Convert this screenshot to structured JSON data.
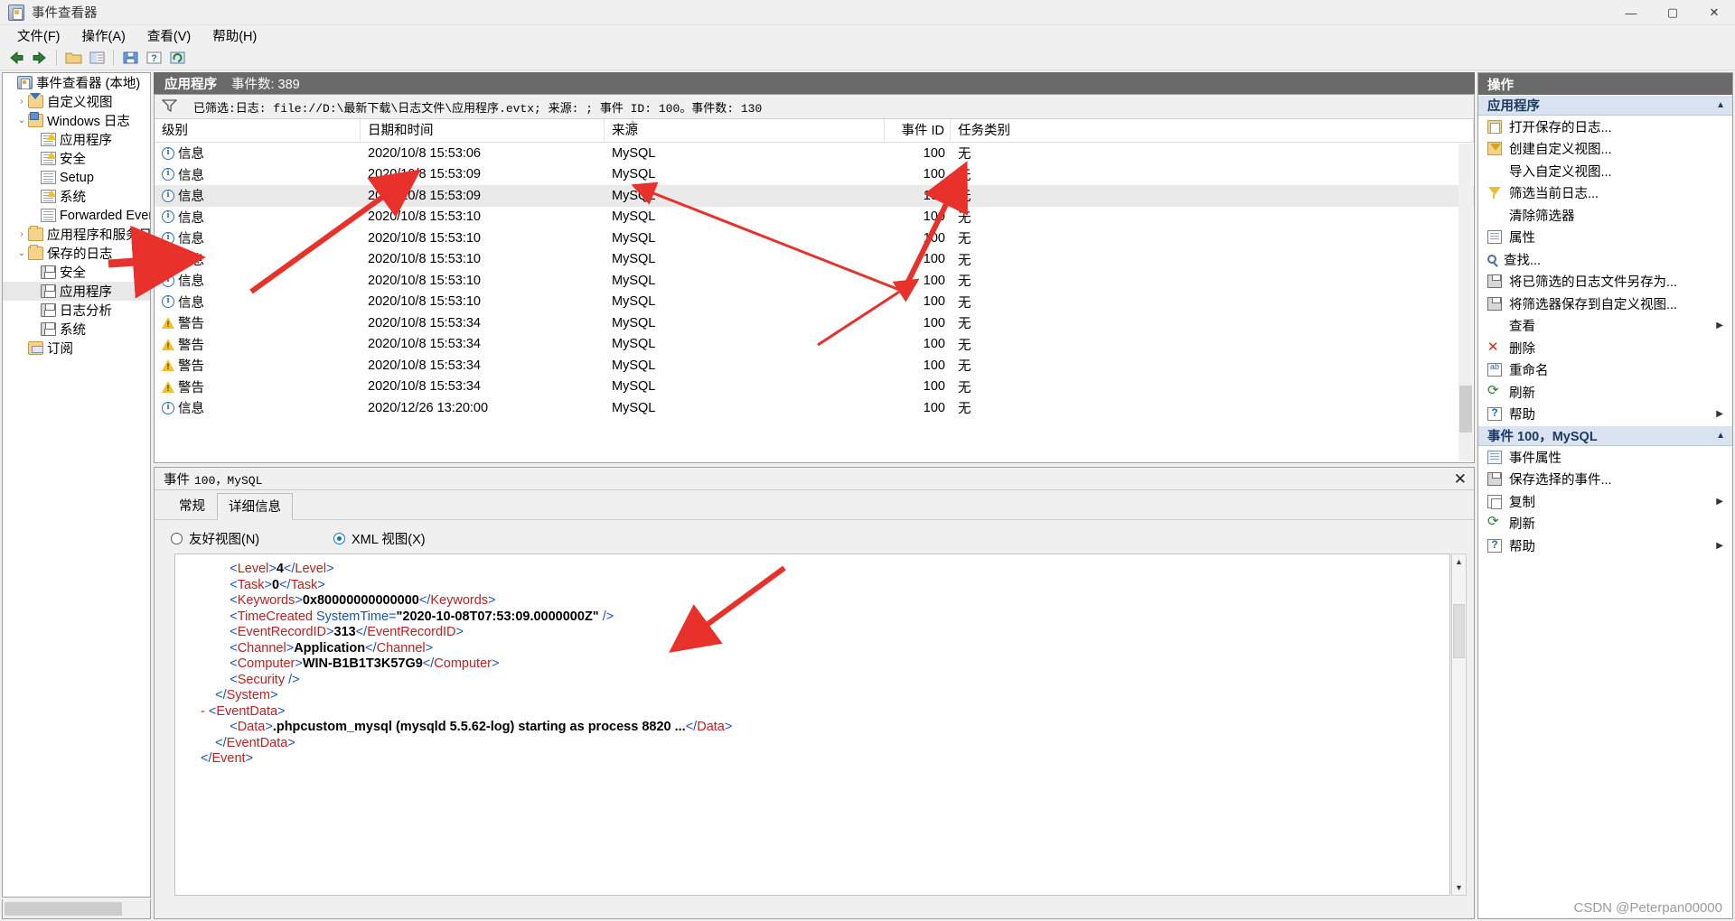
{
  "window": {
    "title": "事件查看器",
    "minimize": "—",
    "maximize": "▢",
    "close": "✕"
  },
  "menubar": [
    {
      "label": "文件(F)"
    },
    {
      "label": "操作(A)"
    },
    {
      "label": "查看(V)"
    },
    {
      "label": "帮助(H)"
    }
  ],
  "tree": {
    "root": "事件查看器 (本地)",
    "items": [
      {
        "label": "自定义视图",
        "indent": 1,
        "twist": "›",
        "icon": "custom-view-folder-icon",
        "selected": false
      },
      {
        "label": "Windows 日志",
        "indent": 1,
        "twist": "⌄",
        "icon": "windows-logs-folder-icon",
        "selected": false
      },
      {
        "label": "应用程序",
        "indent": 2,
        "twist": "",
        "icon": "log-warn-icon",
        "selected": false
      },
      {
        "label": "安全",
        "indent": 2,
        "twist": "",
        "icon": "log-warn-icon",
        "selected": false
      },
      {
        "label": "Setup",
        "indent": 2,
        "twist": "",
        "icon": "log-icon",
        "selected": false
      },
      {
        "label": "系统",
        "indent": 2,
        "twist": "",
        "icon": "log-warn-icon",
        "selected": false
      },
      {
        "label": "Forwarded Events",
        "indent": 2,
        "twist": "",
        "icon": "log-icon",
        "selected": false
      },
      {
        "label": "应用程序和服务日志",
        "indent": 1,
        "twist": "›",
        "icon": "services-folder-icon",
        "selected": false
      },
      {
        "label": "保存的日志",
        "indent": 1,
        "twist": "⌄",
        "icon": "saved-logs-folder-icon",
        "selected": false
      },
      {
        "label": "安全",
        "indent": 2,
        "twist": "",
        "icon": "saved-log-icon",
        "selected": false
      },
      {
        "label": "应用程序",
        "indent": 2,
        "twist": "",
        "icon": "saved-log-icon",
        "selected": true
      },
      {
        "label": "日志分析",
        "indent": 2,
        "twist": "",
        "icon": "saved-log-icon",
        "selected": false
      },
      {
        "label": "系统",
        "indent": 2,
        "twist": "",
        "icon": "saved-log-icon",
        "selected": false
      },
      {
        "label": "订阅",
        "indent": 1,
        "twist": "",
        "icon": "subscriptions-icon",
        "selected": false
      }
    ]
  },
  "list": {
    "header_title": "应用程序",
    "header_count": "事件数: 389",
    "filter_text": "已筛选:日志: file://D:\\最新下载\\日志文件\\应用程序.evtx; 来源: ; 事件 ID: 100。事件数: 130",
    "columns": [
      "级别",
      "日期和时间",
      "来源",
      "事件 ID",
      "任务类别"
    ],
    "rows": [
      {
        "level": "信息",
        "level_icon": "information-icon",
        "datetime": "2020/10/8 15:53:06",
        "source": "MySQL",
        "event_id": "100",
        "task": "无",
        "selected": false
      },
      {
        "level": "信息",
        "level_icon": "information-icon",
        "datetime": "2020/10/8 15:53:09",
        "source": "MySQL",
        "event_id": "100",
        "task": "无",
        "selected": false
      },
      {
        "level": "信息",
        "level_icon": "information-icon",
        "datetime": "2020/10/8 15:53:09",
        "source": "MySQL",
        "event_id": "100",
        "task": "无",
        "selected": true
      },
      {
        "level": "信息",
        "level_icon": "information-icon",
        "datetime": "2020/10/8 15:53:10",
        "source": "MySQL",
        "event_id": "100",
        "task": "无",
        "selected": false
      },
      {
        "level": "信息",
        "level_icon": "information-icon",
        "datetime": "2020/10/8 15:53:10",
        "source": "MySQL",
        "event_id": "100",
        "task": "无",
        "selected": false
      },
      {
        "level": "信息",
        "level_icon": "information-icon",
        "datetime": "2020/10/8 15:53:10",
        "source": "MySQL",
        "event_id": "100",
        "task": "无",
        "selected": false
      },
      {
        "level": "信息",
        "level_icon": "information-icon",
        "datetime": "2020/10/8 15:53:10",
        "source": "MySQL",
        "event_id": "100",
        "task": "无",
        "selected": false
      },
      {
        "level": "信息",
        "level_icon": "information-icon",
        "datetime": "2020/10/8 15:53:10",
        "source": "MySQL",
        "event_id": "100",
        "task": "无",
        "selected": false
      },
      {
        "level": "警告",
        "level_icon": "warning-icon",
        "datetime": "2020/10/8 15:53:34",
        "source": "MySQL",
        "event_id": "100",
        "task": "无",
        "selected": false
      },
      {
        "level": "警告",
        "level_icon": "warning-icon",
        "datetime": "2020/10/8 15:53:34",
        "source": "MySQL",
        "event_id": "100",
        "task": "无",
        "selected": false
      },
      {
        "level": "警告",
        "level_icon": "warning-icon",
        "datetime": "2020/10/8 15:53:34",
        "source": "MySQL",
        "event_id": "100",
        "task": "无",
        "selected": false
      },
      {
        "level": "警告",
        "level_icon": "warning-icon",
        "datetime": "2020/10/8 15:53:34",
        "source": "MySQL",
        "event_id": "100",
        "task": "无",
        "selected": false
      },
      {
        "level": "信息",
        "level_icon": "information-icon",
        "datetime": "2020/12/26 13:20:00",
        "source": "MySQL",
        "event_id": "100",
        "task": "无",
        "selected": false
      }
    ]
  },
  "detail": {
    "title_prefix": "事件",
    "title_rest": "100，MySQL",
    "close": "✕",
    "tabs": [
      {
        "label": "常规",
        "active": false
      },
      {
        "label": "详细信息",
        "active": true
      }
    ],
    "radios": [
      {
        "label": "友好视图(N)",
        "selected": false
      },
      {
        "label": "XML 视图(X)",
        "selected": true
      }
    ],
    "xml_lines": [
      {
        "indent": 4,
        "parts": [
          {
            "t": "b",
            "s": "<"
          },
          {
            "t": "n",
            "s": "Level"
          },
          {
            "t": "b",
            "s": ">"
          },
          {
            "t": "v",
            "s": "4"
          },
          {
            "t": "b",
            "s": "</"
          },
          {
            "t": "n",
            "s": "Level"
          },
          {
            "t": "b",
            "s": ">"
          }
        ]
      },
      {
        "indent": 4,
        "parts": [
          {
            "t": "b",
            "s": "<"
          },
          {
            "t": "n",
            "s": "Task"
          },
          {
            "t": "b",
            "s": ">"
          },
          {
            "t": "v",
            "s": "0"
          },
          {
            "t": "b",
            "s": "</"
          },
          {
            "t": "n",
            "s": "Task"
          },
          {
            "t": "b",
            "s": ">"
          }
        ]
      },
      {
        "indent": 4,
        "parts": [
          {
            "t": "b",
            "s": "<"
          },
          {
            "t": "n",
            "s": "Keywords"
          },
          {
            "t": "b",
            "s": ">"
          },
          {
            "t": "v",
            "s": "0x80000000000000"
          },
          {
            "t": "b",
            "s": "</"
          },
          {
            "t": "n",
            "s": "Keywords"
          },
          {
            "t": "b",
            "s": ">"
          }
        ]
      },
      {
        "indent": 4,
        "parts": [
          {
            "t": "b",
            "s": "<"
          },
          {
            "t": "n",
            "s": "TimeCreated"
          },
          {
            "t": "b",
            "s": " "
          },
          {
            "t": "a",
            "s": "SystemTime"
          },
          {
            "t": "b",
            "s": "="
          },
          {
            "t": "v",
            "s": "\"2020-10-08T07:53:09.0000000Z\""
          },
          {
            "t": "b",
            "s": " />"
          }
        ]
      },
      {
        "indent": 4,
        "parts": [
          {
            "t": "b",
            "s": "<"
          },
          {
            "t": "n",
            "s": "EventRecordID"
          },
          {
            "t": "b",
            "s": ">"
          },
          {
            "t": "v",
            "s": "313"
          },
          {
            "t": "b",
            "s": "</"
          },
          {
            "t": "n",
            "s": "EventRecordID"
          },
          {
            "t": "b",
            "s": ">"
          }
        ]
      },
      {
        "indent": 4,
        "parts": [
          {
            "t": "b",
            "s": "<"
          },
          {
            "t": "n",
            "s": "Channel"
          },
          {
            "t": "b",
            "s": ">"
          },
          {
            "t": "v",
            "s": "Application"
          },
          {
            "t": "b",
            "s": "</"
          },
          {
            "t": "n",
            "s": "Channel"
          },
          {
            "t": "b",
            "s": ">"
          }
        ]
      },
      {
        "indent": 4,
        "parts": [
          {
            "t": "b",
            "s": "<"
          },
          {
            "t": "n",
            "s": "Computer"
          },
          {
            "t": "b",
            "s": ">"
          },
          {
            "t": "v",
            "s": "WIN-B1B1T3K57G9"
          },
          {
            "t": "b",
            "s": "</"
          },
          {
            "t": "n",
            "s": "Computer"
          },
          {
            "t": "b",
            "s": ">"
          }
        ]
      },
      {
        "indent": 4,
        "parts": [
          {
            "t": "b",
            "s": "<"
          },
          {
            "t": "n",
            "s": "Security"
          },
          {
            "t": "b",
            "s": " />"
          }
        ]
      },
      {
        "indent": 2,
        "parts": [
          {
            "t": "b",
            "s": "</"
          },
          {
            "t": "n",
            "s": "System"
          },
          {
            "t": "b",
            "s": ">"
          }
        ]
      },
      {
        "indent": 0,
        "parts": [
          {
            "t": "m",
            "s": "- "
          },
          {
            "t": "b",
            "s": "<"
          },
          {
            "t": "n",
            "s": "EventData"
          },
          {
            "t": "b",
            "s": ">"
          }
        ]
      },
      {
        "indent": 4,
        "parts": [
          {
            "t": "b",
            "s": "<"
          },
          {
            "t": "n",
            "s": "Data"
          },
          {
            "t": "b",
            "s": ">"
          },
          {
            "t": "v",
            "s": ".phpcustom_mysql (mysqld 5.5.62-log) starting as process 8820 ..."
          },
          {
            "t": "b",
            "s": "</"
          },
          {
            "t": "n",
            "s": "Data"
          },
          {
            "t": "b",
            "s": ">"
          }
        ]
      },
      {
        "indent": 2,
        "parts": [
          {
            "t": "b",
            "s": "</"
          },
          {
            "t": "n",
            "s": "EventData"
          },
          {
            "t": "b",
            "s": ">"
          }
        ]
      },
      {
        "indent": 0,
        "parts": [
          {
            "t": "b",
            "s": "</"
          },
          {
            "t": "n",
            "s": "Event"
          },
          {
            "t": "b",
            "s": ">"
          }
        ]
      }
    ]
  },
  "actions": {
    "header": "操作",
    "sections": [
      {
        "title": "应用程序",
        "caret": "▲",
        "items": [
          {
            "label": "打开保存的日志...",
            "icon": "open-saved-log-icon",
            "submenu": ""
          },
          {
            "label": "创建自定义视图...",
            "icon": "create-custom-view-icon",
            "submenu": ""
          },
          {
            "label": "导入自定义视图...",
            "icon": "",
            "submenu": ""
          },
          {
            "label": "筛选当前日志...",
            "icon": "filter-icon",
            "submenu": ""
          },
          {
            "label": "清除筛选器",
            "icon": "",
            "submenu": ""
          },
          {
            "label": "属性",
            "icon": "properties-icon",
            "submenu": ""
          },
          {
            "label": "查找...",
            "icon": "find-icon",
            "submenu": ""
          },
          {
            "label": "将已筛选的日志文件另存为...",
            "icon": "save-log-icon",
            "submenu": ""
          },
          {
            "label": "将筛选器保存到自定义视图...",
            "icon": "save-filter-icon",
            "submenu": ""
          },
          {
            "label": "查看",
            "icon": "",
            "submenu": "▶"
          },
          {
            "label": "删除",
            "icon": "delete-icon",
            "submenu": ""
          },
          {
            "label": "重命名",
            "icon": "rename-icon",
            "submenu": ""
          },
          {
            "label": "刷新",
            "icon": "refresh-icon",
            "submenu": ""
          },
          {
            "label": "帮助",
            "icon": "help-icon",
            "submenu": "▶"
          }
        ]
      },
      {
        "title": "事件 100，MySQL",
        "caret": "▲",
        "items": [
          {
            "label": "事件属性",
            "icon": "event-properties-icon",
            "submenu": ""
          },
          {
            "label": "保存选择的事件...",
            "icon": "save-selected-events-icon",
            "submenu": ""
          },
          {
            "label": "复制",
            "icon": "copy-icon",
            "submenu": "▶"
          },
          {
            "label": "刷新",
            "icon": "refresh-icon",
            "submenu": ""
          },
          {
            "label": "帮助",
            "icon": "help-icon",
            "submenu": "▶"
          }
        ]
      }
    ]
  },
  "watermark": "CSDN @Peterpan00000",
  "colors": {
    "header_bar": "#6a6a6a",
    "section_head": "#d9e4f0",
    "arrow_red": "#e8312a",
    "xml_tag": "#c02020",
    "xml_bracket": "#1b52c2"
  }
}
